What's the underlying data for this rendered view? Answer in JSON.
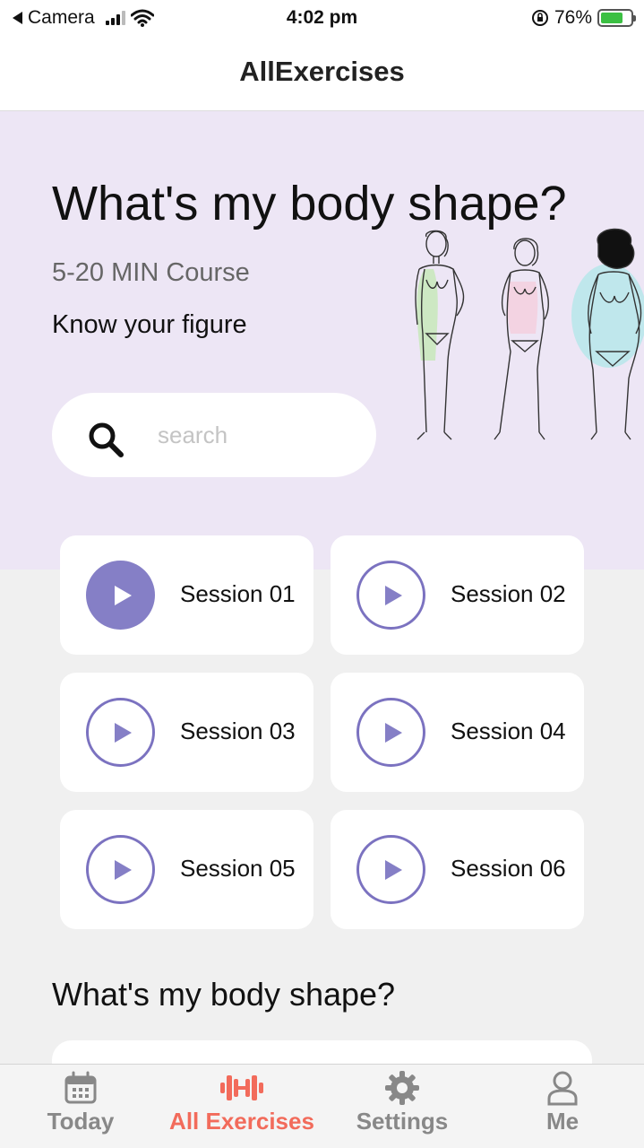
{
  "status_bar": {
    "back_app": "Camera",
    "time": "4:02 pm",
    "battery": "76%",
    "battery_level": 0.76
  },
  "nav": {
    "title": "AllExercises"
  },
  "hero": {
    "title": "What's my body shape?",
    "subtitle": "5-20 MIN Course",
    "tagline": "Know your figure",
    "search_placeholder": "search"
  },
  "sessions": [
    {
      "label": "Session 01",
      "active": true
    },
    {
      "label": "Session 02",
      "active": false
    },
    {
      "label": "Session 03",
      "active": false
    },
    {
      "label": "Session 04",
      "active": false
    },
    {
      "label": "Session 05",
      "active": false
    },
    {
      "label": "Session 06",
      "active": false
    }
  ],
  "section": {
    "title": "What's my body shape?"
  },
  "tabs": [
    {
      "label": "Today",
      "icon": "calendar-icon",
      "active": false
    },
    {
      "label": "All Exercises",
      "icon": "dumbbell-icon",
      "active": true
    },
    {
      "label": "Settings",
      "icon": "gear-icon",
      "active": false
    },
    {
      "label": "Me",
      "icon": "person-icon",
      "active": false
    }
  ],
  "colors": {
    "accent": "#857fc6",
    "hero_bg": "#ede6f5",
    "tab_active": "#f26b5b",
    "tab_inactive": "#888888"
  }
}
